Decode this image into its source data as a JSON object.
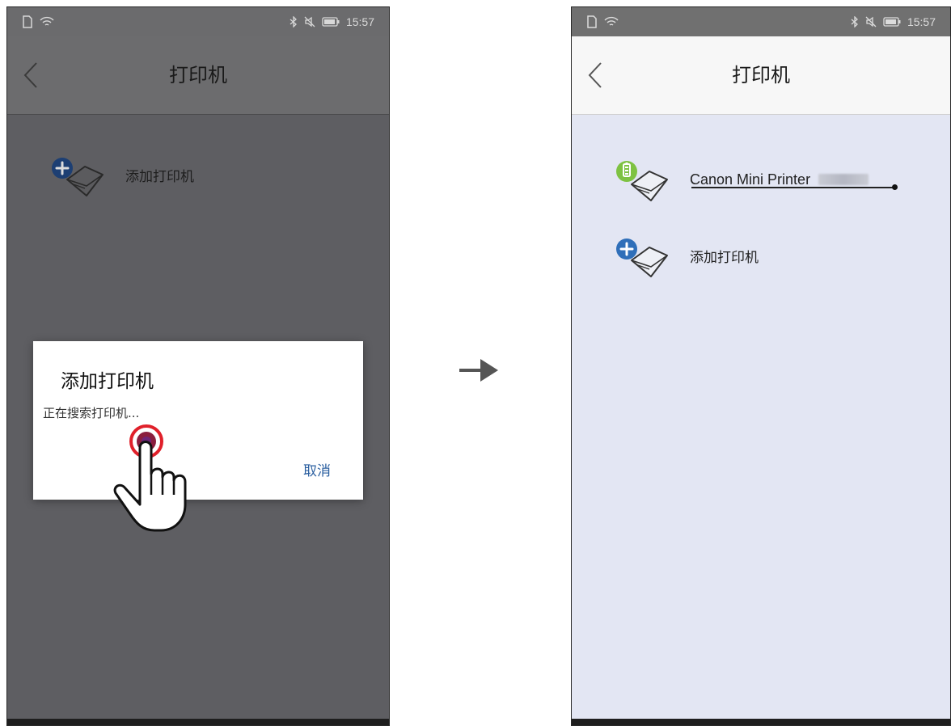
{
  "left_screen": {
    "status_bar": {
      "time": "15:57",
      "icons": [
        "sim-icon",
        "wifi-icon",
        "bluetooth-icon",
        "mute-icon",
        "battery-icon"
      ]
    },
    "header": {
      "title": "打印机",
      "back_icon": "chevron-left-icon"
    },
    "list": [
      {
        "label": "添加打印机",
        "icon": "add-printer-icon"
      }
    ],
    "dialog": {
      "title": "添加打印机",
      "message": "正在搜索打印机...",
      "cancel_label": "取消",
      "tap_indicator": "tap-hand-icon"
    },
    "colors": {
      "overlay": "#5e5e62",
      "dialog_bg": "#ffffff",
      "cancel_text": "#2b5fa0",
      "tap_ring": "#e0202a"
    }
  },
  "transition": {
    "icon": "arrow-right-icon"
  },
  "right_screen": {
    "status_bar": {
      "time": "15:57",
      "icons": [
        "sim-icon",
        "wifi-icon",
        "bluetooth-icon",
        "mute-icon",
        "battery-icon"
      ]
    },
    "header": {
      "title": "打印机",
      "back_icon": "chevron-left-icon"
    },
    "list": [
      {
        "label": "Canon Mini Printer",
        "icon": "connected-printer-icon",
        "status": "connected"
      },
      {
        "label": "添加打印机",
        "icon": "add-printer-icon"
      }
    ],
    "colors": {
      "background": "#e3e6f3",
      "connected_badge": "#7ec242",
      "add_badge": "#2f6fb9"
    }
  }
}
